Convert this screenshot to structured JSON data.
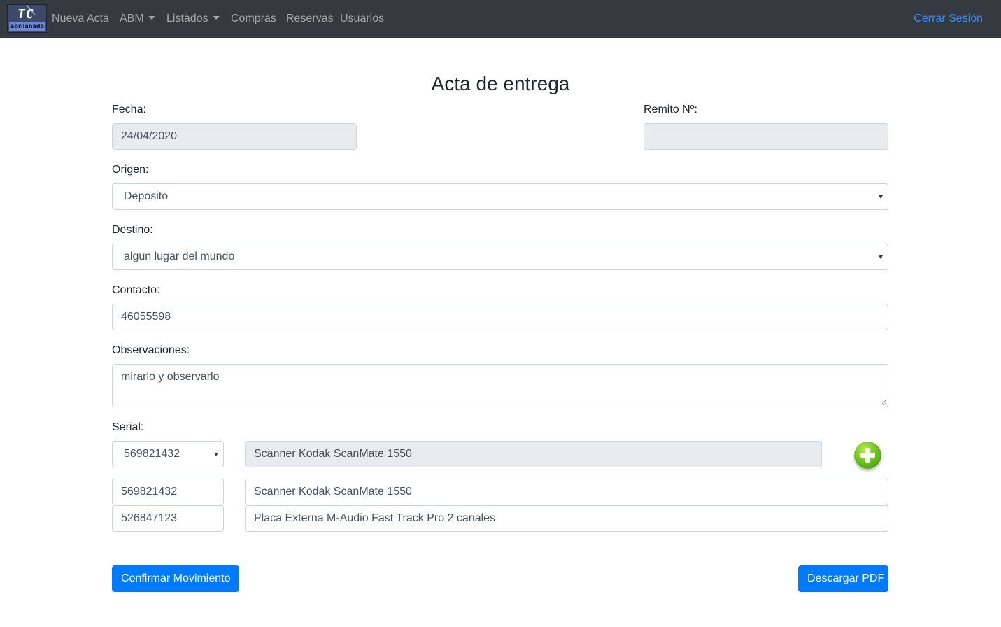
{
  "navbar": {
    "brand_text": "TC",
    "brand_sub": "abrilanado",
    "items": [
      {
        "label": "Nueva Acta",
        "dropdown": false
      },
      {
        "label": "ABM",
        "dropdown": true
      },
      {
        "label": "Listados",
        "dropdown": true
      },
      {
        "label": "Compras",
        "dropdown": false
      },
      {
        "label": "Reservas",
        "dropdown": false
      },
      {
        "label": "Usuarios",
        "dropdown": false
      }
    ],
    "logout_label": "Cerrar Sesión",
    "bg_color": "#343a40",
    "link_color": "#2f8cff"
  },
  "form": {
    "title": "Acta de entrega",
    "fecha_label": "Fecha:",
    "fecha_value": "24/04/2020",
    "remito_label": "Remito Nº:",
    "remito_value": "",
    "origen_label": "Origen:",
    "origen_value": "Deposito",
    "destino_label": "Destino:",
    "destino_value": "algun lugar del mundo",
    "contacto_label": "Contacto:",
    "contacto_value": "46055598",
    "observaciones_label": "Observaciones:",
    "observaciones_value": "mirarlo y observarlo",
    "serial_label": "Serial:",
    "serial_select_value": "569821432",
    "serial_description": "Scanner Kodak ScanMate 1550",
    "items": [
      {
        "serial": "569821432",
        "description": "Scanner Kodak ScanMate 1550"
      },
      {
        "serial": "526847123",
        "description": "Placa Externa M-Audio Fast Track Pro 2 canales"
      }
    ]
  },
  "actions": {
    "confirm_label": "Confirmar Movimiento",
    "pdf_label": "Descargar PDF",
    "primary_color": "#007bff"
  },
  "icons": {
    "add": "plus-circle-icon",
    "dropdown": "caret-down-icon"
  }
}
